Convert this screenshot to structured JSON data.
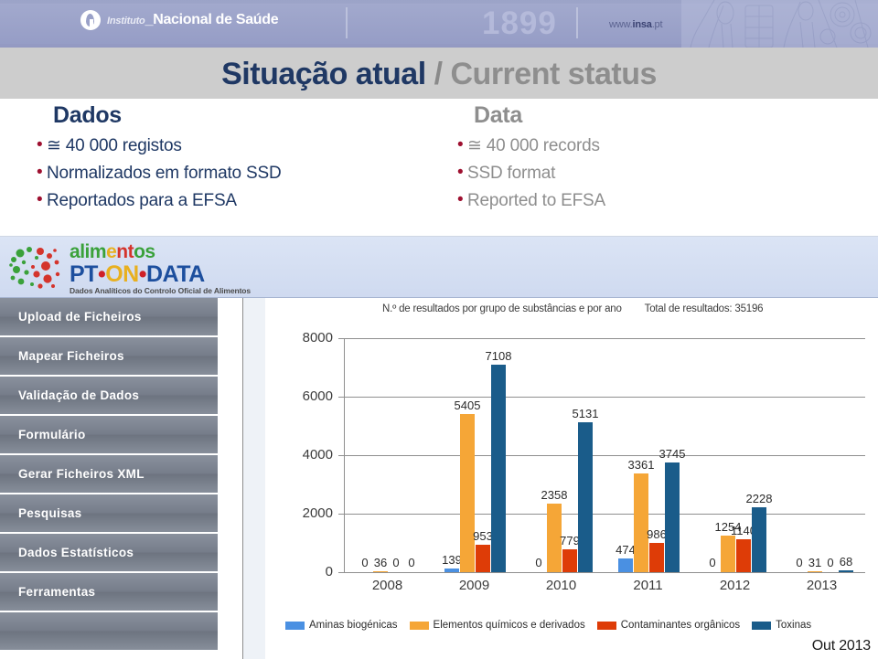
{
  "banner": {
    "logo_italic": "Instituto",
    "logo_underscore": "_",
    "logo_main": "Nacional de Saúde",
    "year": "1899",
    "url_prefix": "www.",
    "url_brand": "insa",
    "url_suffix": ".pt"
  },
  "title": {
    "pt": "Situação atual",
    "separator": "/",
    "en": "Current status"
  },
  "columns": {
    "pt": {
      "heading": "Dados",
      "bullets": [
        "≅ 40 000 registos",
        "Normalizados em formato SSD",
        "Reportados para a EFSA"
      ]
    },
    "en": {
      "heading": "Data",
      "bullets": [
        "≅ 40 000 records",
        "SSD format",
        "Reported to EFSA"
      ]
    }
  },
  "app": {
    "logo": {
      "line1": "alimentos",
      "line2_a": "PT",
      "line2_dot1": "•",
      "line2_b": "ON",
      "line2_dot2": "•",
      "line2_c": "DATA",
      "subtitle": "Dados Analíticos do Controlo Oficial de Alimentos"
    },
    "sidebar": {
      "items": [
        {
          "label": "Upload de Ficheiros"
        },
        {
          "label": "Mapear Ficheiros"
        },
        {
          "label": "Validação de Dados"
        },
        {
          "label": "Formulário"
        },
        {
          "label": "Gerar Ficheiros XML"
        },
        {
          "label": "Pesquisas"
        },
        {
          "label": "Dados Estatísticos"
        },
        {
          "label": "Ferramentas"
        }
      ]
    }
  },
  "footer": {
    "date": "Out 2013"
  },
  "chart_data": {
    "type": "bar",
    "title": "N.º de resultados por grupo de substâncias e por ano",
    "subtitle": "Total de resultados: 35196",
    "xlabel": "",
    "ylabel": "",
    "ylim": [
      0,
      8000
    ],
    "yticks": [
      0,
      2000,
      4000,
      6000,
      8000
    ],
    "ytick_labels": [
      "0",
      "2000",
      "4000",
      "6000",
      "8000"
    ],
    "grid": true,
    "legend_position": "bottom",
    "categories": [
      "2008",
      "2009",
      "2010",
      "2011",
      "2012",
      "2013"
    ],
    "series": [
      {
        "name": "Aminas biogénicas",
        "color": "#4a90e2",
        "values": [
          0,
          139,
          0,
          474,
          0,
          0
        ]
      },
      {
        "name": "Elementos químicos e derivados",
        "color": "#f5a637",
        "values": [
          36,
          5405,
          2358,
          3361,
          1254,
          31
        ]
      },
      {
        "name": "Contaminantes orgânicos",
        "color": "#de3c07",
        "values": [
          0,
          953,
          779,
          986,
          1140,
          0
        ]
      },
      {
        "name": "Toxinas",
        "color": "#1a5c8a",
        "values": [
          0,
          7108,
          5131,
          3745,
          2228,
          68
        ]
      }
    ]
  }
}
